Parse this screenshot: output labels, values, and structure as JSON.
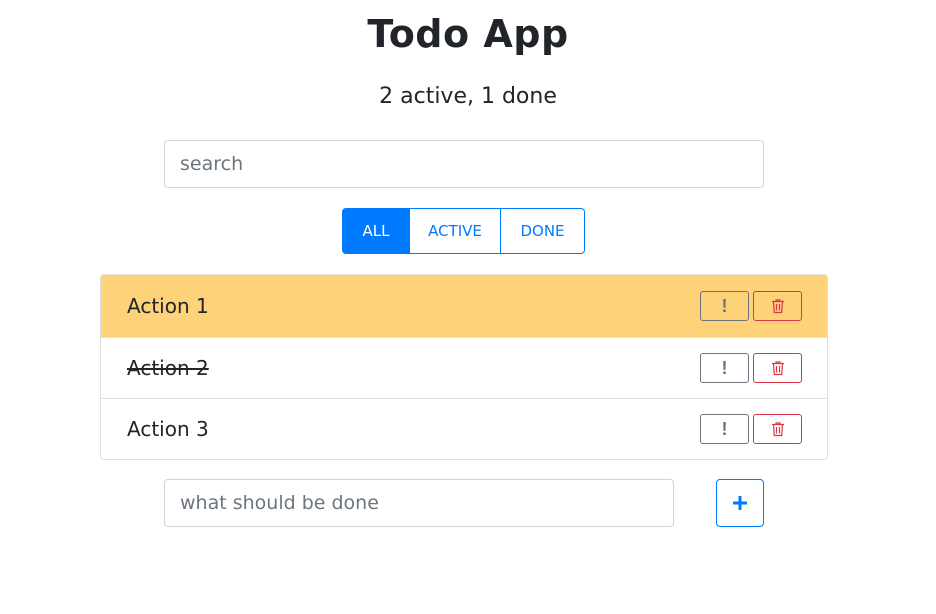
{
  "header": {
    "title": "Todo App",
    "status": "2 active, 1 done"
  },
  "search": {
    "placeholder": "search",
    "value": ""
  },
  "filters": [
    {
      "label": "ALL",
      "selected": true
    },
    {
      "label": "ACTIVE",
      "selected": false
    },
    {
      "label": "DONE",
      "selected": false
    }
  ],
  "todos": [
    {
      "label": "Action 1",
      "important": true,
      "done": false,
      "important_icon": "exclamation-icon",
      "delete_icon": "trash-icon"
    },
    {
      "label": "Action 2",
      "important": false,
      "done": true,
      "important_icon": "exclamation-icon",
      "delete_icon": "trash-icon"
    },
    {
      "label": "Action 3",
      "important": false,
      "done": false,
      "important_icon": "exclamation-icon",
      "delete_icon": "trash-icon"
    }
  ],
  "new_item": {
    "placeholder": "what should be done",
    "value": "",
    "add_icon": "plus-icon"
  },
  "colors": {
    "primary": "#007bff",
    "important_bg": "#fdd279",
    "danger": "#dc3545",
    "secondary": "#6c757d"
  }
}
